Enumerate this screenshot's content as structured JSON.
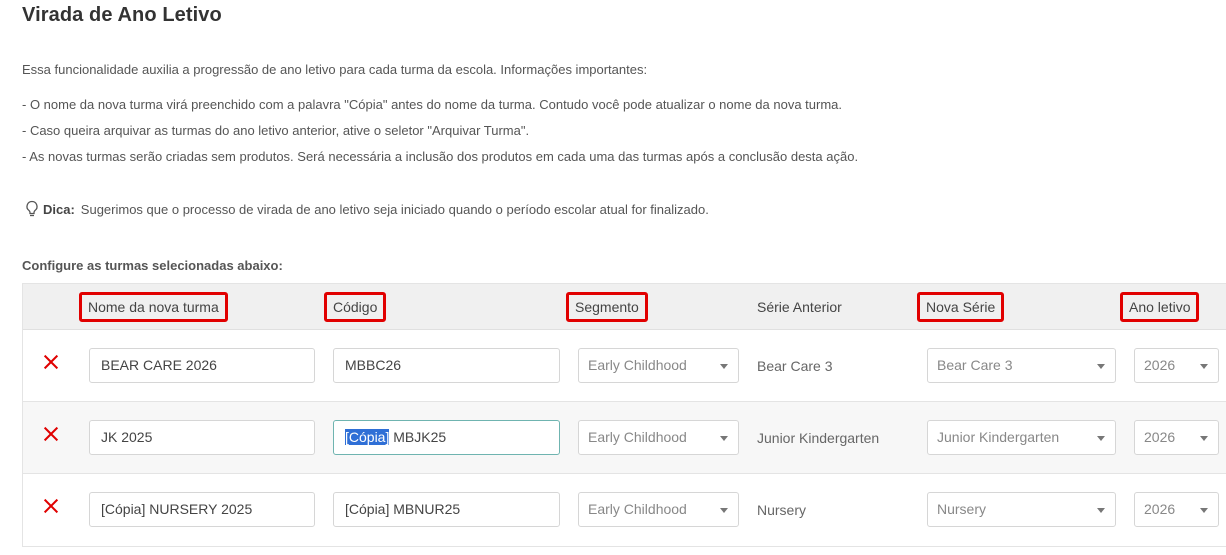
{
  "page": {
    "title": "Virada de Ano Letivo",
    "intro": "Essa funcionalidade auxilia a progressão de ano letivo para cada turma da escola. Informações importantes:",
    "bullets": [
      "- O nome da nova turma virá preenchido com a palavra \"Cópia\" antes do nome da turma. Contudo você pode atualizar o nome da nova turma.",
      "- Caso queira arquivar as turmas do ano letivo anterior, ative o seletor \"Arquivar Turma\".",
      "- As novas turmas serão criadas sem produtos. Será necessária a inclusão dos produtos em cada uma das turmas após a conclusão desta ação."
    ],
    "tip": {
      "icon": "lightbulb-icon",
      "label": "Dica:",
      "text": "Sugerimos que o processo de virada de ano letivo seja iniciado quando o período escolar atual for finalizado."
    },
    "section_label": "Configure as turmas selecionadas abaixo:"
  },
  "table": {
    "headers": {
      "nome": "Nome da nova turma",
      "codigo": "Código",
      "segmento": "Segmento",
      "serie_anterior": "Série Anterior",
      "nova_serie": "Nova Série",
      "ano_letivo": "Ano letivo"
    },
    "highlight_color": "#e10000",
    "rows": [
      {
        "nome": "BEAR CARE 2026",
        "codigo": "MBBC26",
        "segmento": "Early Childhood",
        "serie_anterior": "Bear Care 3",
        "nova_serie": "Bear Care 3",
        "ano_letivo": "2026"
      },
      {
        "nome": "JK 2025",
        "codigo_selected": "[Cópia]",
        "codigo_rest": " MBJK25",
        "segmento": "Early Childhood",
        "serie_anterior": "Junior Kindergarten",
        "nova_serie": "Junior Kindergarten",
        "ano_letivo": "2026"
      },
      {
        "nome": "[Cópia] NURSERY 2025",
        "codigo": "[Cópia] MBNUR25",
        "segmento": "Early Childhood",
        "serie_anterior": "Nursery",
        "nova_serie": "Nursery",
        "ano_letivo": "2026"
      }
    ]
  }
}
